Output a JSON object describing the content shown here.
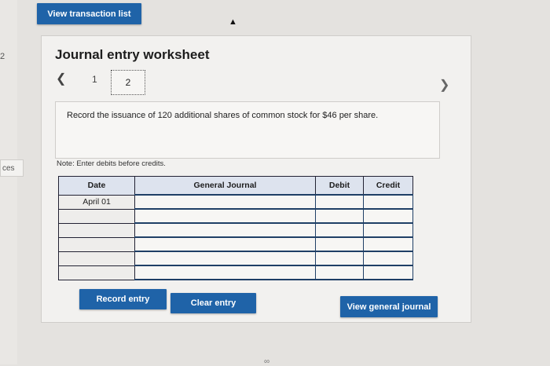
{
  "sidebar": {
    "edge_number": "2",
    "edge_label": "ces"
  },
  "header": {
    "view_transactions_label": "View transaction list"
  },
  "worksheet": {
    "title": "Journal entry worksheet",
    "pagination": {
      "prev_icon": "chevron-left",
      "pages": [
        "1",
        "2"
      ],
      "current": "2",
      "next_icon": "chevron-right"
    },
    "instruction": "Record the issuance of 120 additional shares of common stock for $46 per share.",
    "note": "Note: Enter debits before credits.",
    "table": {
      "columns": [
        "Date",
        "General Journal",
        "Debit",
        "Credit"
      ],
      "rows": [
        {
          "date": "April 01",
          "account": "",
          "debit": "",
          "credit": ""
        },
        {
          "date": "",
          "account": "",
          "debit": "",
          "credit": ""
        },
        {
          "date": "",
          "account": "",
          "debit": "",
          "credit": ""
        },
        {
          "date": "",
          "account": "",
          "debit": "",
          "credit": ""
        },
        {
          "date": "",
          "account": "",
          "debit": "",
          "credit": ""
        },
        {
          "date": "",
          "account": "",
          "debit": "",
          "credit": ""
        }
      ]
    },
    "buttons": {
      "record": "Record entry",
      "clear": "Clear entry",
      "view_general_journal": "View general journal"
    }
  },
  "colors": {
    "button_blue": "#1f63a8",
    "header_fill": "#dde3ee",
    "background": "#e4e2df"
  }
}
